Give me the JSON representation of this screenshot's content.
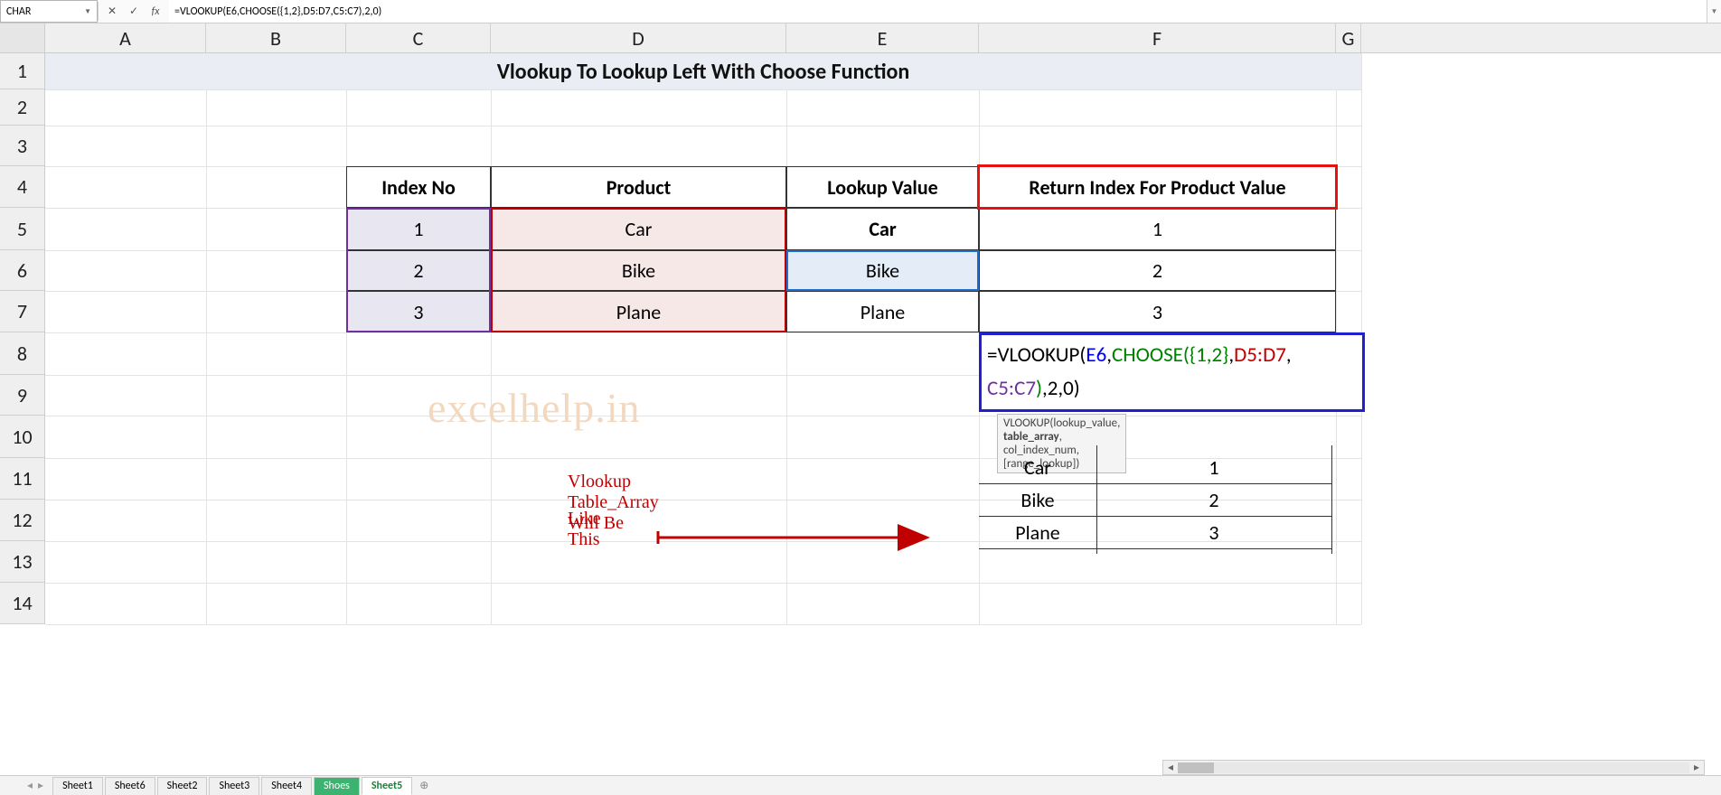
{
  "formula_bar": {
    "name_box": "CHAR",
    "cancel_icon": "✕",
    "enter_icon": "✓",
    "fx_icon": "fx",
    "formula": "=VLOOKUP(E6,CHOOSE({1,2},D5:D7,C5:C7),2,0)"
  },
  "columns": [
    "A",
    "B",
    "C",
    "D",
    "E",
    "F",
    "G"
  ],
  "rows": [
    "1",
    "2",
    "3",
    "4",
    "5",
    "6",
    "7",
    "8",
    "9",
    "10",
    "11",
    "12",
    "13",
    "14"
  ],
  "title": "Vlookup To Lookup Left With Choose Function",
  "table": {
    "head_index": "Index No",
    "head_product": "Product",
    "head_lookup": "Lookup Value",
    "head_return": "Return Index For Product Value",
    "r1": {
      "idx": "1",
      "prod": "Car",
      "look": "Car",
      "ret": "1"
    },
    "r2": {
      "idx": "2",
      "prod": "Bike",
      "look": "Bike",
      "ret": "2"
    },
    "r3": {
      "idx": "3",
      "prod": "Plane",
      "look": "Plane",
      "ret": "3"
    }
  },
  "colored_formula": {
    "p1": "=VLOOKUP(",
    "p2": "E6",
    "p3": ",",
    "p4": "CHOOSE(",
    "p5": "{1,2}",
    "p6": ",",
    "p7": "D5:D7",
    "p8": ",",
    "p9": "C5:C7",
    "p10": ")",
    "p11": ",2,0)"
  },
  "tooltip": {
    "fn": "VLOOKUP(",
    "a1": "lookup_value",
    "sep1": ", ",
    "a2": "table_array",
    "sep2": ", ",
    "a3": "col_index_num",
    "sep3": ", ",
    "a4": "[range_lookup]",
    "end": ")"
  },
  "watermark": "excelhelp.in",
  "annotation": {
    "line1": "Vlookup Table_Array Will Be",
    "line2": "Like This"
  },
  "virtual_table": {
    "r1": {
      "c1": "Car",
      "c2": "1"
    },
    "r2": {
      "c1": "Bike",
      "c2": "2"
    },
    "r3": {
      "c1": "Plane",
      "c2": "3"
    }
  },
  "sheet_tabs": [
    "Sheet1",
    "Sheet6",
    "Sheet2",
    "Sheet3",
    "Sheet4",
    "Shoes",
    "Sheet5"
  ],
  "plus_icon": "⊕",
  "col_widths": {
    "A": 178,
    "B": 155,
    "C": 160,
    "D": 327,
    "E": 213,
    "F": 395,
    "G": 28
  },
  "row_heights": {
    "header": 33,
    "r1": 40,
    "r2": 40,
    "r3": 45,
    "r4": 46,
    "r5": 47,
    "r6": 45,
    "r7": 46,
    "r8": 47,
    "r9": 45,
    "r10": 47,
    "r11": 46,
    "r12": 46,
    "r13": 46,
    "r14": 46
  }
}
